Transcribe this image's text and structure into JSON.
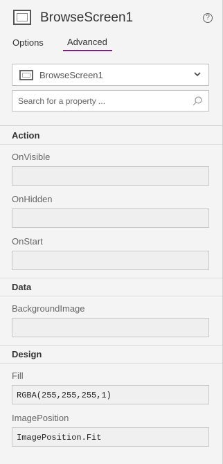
{
  "header": {
    "title": "BrowseScreen1",
    "help": "?"
  },
  "tabs": [
    {
      "label": "Options",
      "selected": false
    },
    {
      "label": "Advanced",
      "selected": true
    }
  ],
  "selector": {
    "value": "BrowseScreen1"
  },
  "search": {
    "placeholder": "Search for a property ..."
  },
  "sections": {
    "action": {
      "title": "Action",
      "props": [
        {
          "label": "OnVisible",
          "value": ""
        },
        {
          "label": "OnHidden",
          "value": ""
        },
        {
          "label": "OnStart",
          "value": ""
        }
      ]
    },
    "data": {
      "title": "Data",
      "props": [
        {
          "label": "BackgroundImage",
          "value": ""
        }
      ]
    },
    "design": {
      "title": "Design",
      "props": [
        {
          "label": "Fill",
          "value": "RGBA(255,255,255,1)"
        },
        {
          "label": "ImagePosition",
          "value": "ImagePosition.Fit"
        }
      ]
    }
  },
  "colors": {
    "accent": "#742774",
    "panel_bg": "#f4f4f4"
  }
}
